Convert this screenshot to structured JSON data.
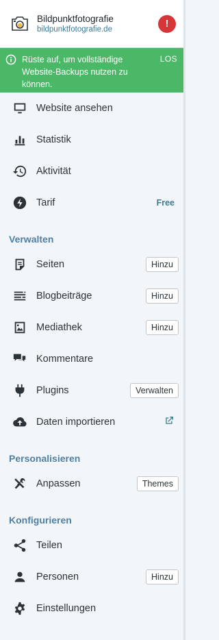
{
  "site": {
    "title": "Bildpunktfotografie",
    "url": "bildpunktfotografie.de",
    "alert": "!"
  },
  "notice": {
    "text": "Rüste auf, um vollständige Website-Backups nutzen zu können.",
    "action": "LOS",
    "color": "#4ab866"
  },
  "menu_top": [
    {
      "label": "Website ansehen",
      "icon": "monitor-icon"
    },
    {
      "label": "Statistik",
      "icon": "bar-chart-icon"
    },
    {
      "label": "Aktivität",
      "icon": "history-icon"
    },
    {
      "label": "Tarif",
      "icon": "plan-icon",
      "badge": "Free"
    }
  ],
  "sections": {
    "manage": "Verwalten",
    "personalize": "Personalisieren",
    "configure": "Konfigurieren"
  },
  "menu_manage": [
    {
      "label": "Seiten",
      "icon": "page-icon",
      "action": "Hinzu"
    },
    {
      "label": "Blogbeiträge",
      "icon": "posts-icon",
      "action": "Hinzu"
    },
    {
      "label": "Mediathek",
      "icon": "media-icon",
      "action": "Hinzu"
    },
    {
      "label": "Kommentare",
      "icon": "comments-icon"
    },
    {
      "label": "Plugins",
      "icon": "plugin-icon",
      "action": "Verwalten"
    },
    {
      "label": "Daten importieren",
      "icon": "cloud-upload-icon",
      "external": "external-link-icon"
    }
  ],
  "menu_personalize": [
    {
      "label": "Anpassen",
      "icon": "tools-icon",
      "action": "Themes"
    }
  ],
  "menu_configure": [
    {
      "label": "Teilen",
      "icon": "share-icon"
    },
    {
      "label": "Personen",
      "icon": "person-icon",
      "action": "Hinzu"
    },
    {
      "label": "Einstellungen",
      "icon": "gear-icon"
    }
  ],
  "colors": {
    "accent": "#3c7a94",
    "section": "#4f7fa3",
    "alert": "#d63638"
  }
}
